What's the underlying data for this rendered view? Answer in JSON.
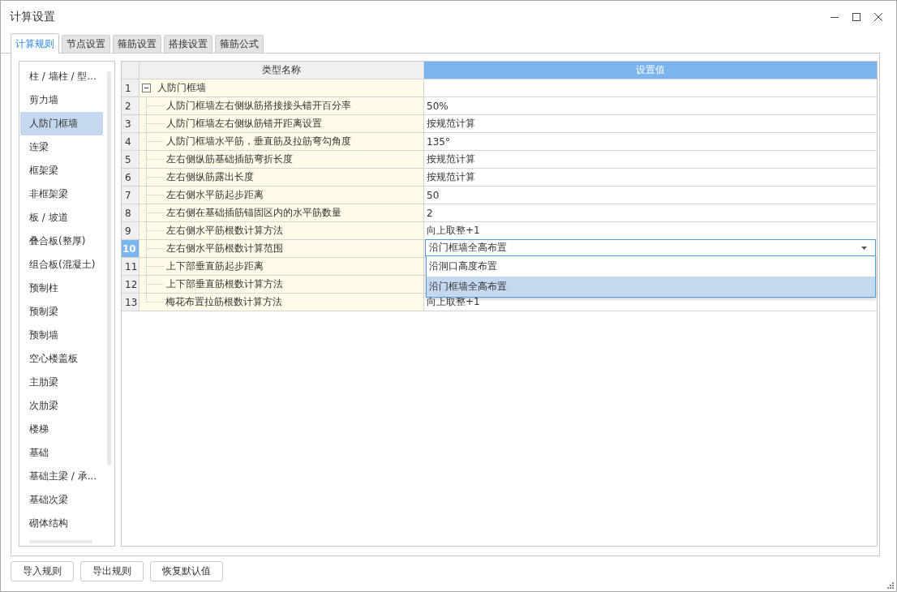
{
  "window": {
    "title": "计算设置"
  },
  "tabs": [
    {
      "label": "计算规则",
      "selected": true
    },
    {
      "label": "节点设置",
      "selected": false
    },
    {
      "label": "箍筋设置",
      "selected": false
    },
    {
      "label": "搭接设置",
      "selected": false
    },
    {
      "label": "箍筋公式",
      "selected": false
    }
  ],
  "sidebar": {
    "items": [
      {
        "label": "柱 / 墙柱 / 型...",
        "selected": false
      },
      {
        "label": "剪力墙",
        "selected": false
      },
      {
        "label": "人防门框墙",
        "selected": true
      },
      {
        "label": "连梁",
        "selected": false
      },
      {
        "label": "框架梁",
        "selected": false
      },
      {
        "label": "非框架梁",
        "selected": false
      },
      {
        "label": "板 / 坡道",
        "selected": false
      },
      {
        "label": "叠合板(整厚)",
        "selected": false
      },
      {
        "label": "组合板(混凝土)",
        "selected": false
      },
      {
        "label": "预制柱",
        "selected": false
      },
      {
        "label": "预制梁",
        "selected": false
      },
      {
        "label": "预制墙",
        "selected": false
      },
      {
        "label": "空心楼盖板",
        "selected": false
      },
      {
        "label": "主肋梁",
        "selected": false
      },
      {
        "label": "次肋梁",
        "selected": false
      },
      {
        "label": "楼梯",
        "selected": false
      },
      {
        "label": "基础",
        "selected": false
      },
      {
        "label": "基础主梁 / 承...",
        "selected": false
      },
      {
        "label": "基础次梁",
        "selected": false
      },
      {
        "label": "砌体结构",
        "selected": false
      }
    ]
  },
  "table": {
    "columns": [
      "类型名称",
      "设置值"
    ],
    "rows": [
      {
        "number": "1",
        "name": "人防门框墙",
        "expanded": true,
        "selected": false,
        "children": [
          {
            "number": "2",
            "name": "人防门框墙左右侧纵筋搭接接头错开百分率",
            "value": "50%",
            "selected": false
          },
          {
            "number": "3",
            "name": "人防门框墙左右侧纵筋错开距离设置",
            "value": "按规范计算",
            "selected": false
          },
          {
            "number": "4",
            "name": "人防门框墙水平筋，垂直筋及拉筋弯勾角度",
            "value": "135°",
            "selected": false
          },
          {
            "number": "5",
            "name": "左右侧纵筋基础插筋弯折长度",
            "value": "按规范计算",
            "selected": false
          },
          {
            "number": "6",
            "name": "左右侧纵筋露出长度",
            "value": "按规范计算",
            "selected": false
          },
          {
            "number": "7",
            "name": "左右侧水平筋起步距离",
            "value": "50",
            "selected": false
          },
          {
            "number": "8",
            "name": "左右侧在基础插筋锚固区内的水平筋数量",
            "value": "2",
            "selected": false
          },
          {
            "number": "9",
            "name": "左右侧水平筋根数计算方法",
            "value": "向上取整+1",
            "selected": false
          },
          {
            "number": "10",
            "name": "左右侧水平筋根数计算范围",
            "value": "沿门框墙全高布置",
            "selected": true,
            "options": [
              {
                "label": "沿洞口高度布置",
                "selected": false
              },
              {
                "label": "沿门框墙全高布置",
                "selected": true
              }
            ]
          },
          {
            "number": "11",
            "name": "上下部垂直筋起步距离",
            "selected": false
          },
          {
            "number": "12",
            "name": "上下部垂直筋根数计算方法",
            "selected": false
          },
          {
            "number": "13",
            "name": "梅花布置拉筋根数计算方法",
            "value": "向上取整+1",
            "selected": false
          }
        ]
      }
    ]
  },
  "buttons": [
    "导入规则",
    "导出规则",
    "恢复默认值"
  ]
}
